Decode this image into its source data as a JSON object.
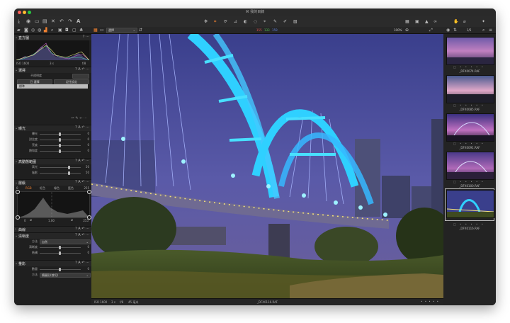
{
  "window": {
    "title": "⌘ 我的目錄",
    "traffic_colors": [
      "#ff5f57",
      "#febc2e",
      "#28c840"
    ]
  },
  "toolbar": {
    "left_icons": [
      "import-icon",
      "library-icon",
      "layers-icon",
      "filmstrip-icon",
      "close-icon",
      "undo-icon",
      "redo-icon",
      "text-icon"
    ],
    "center_icons": [
      "pan-icon",
      "crop-icon",
      "rotate-icon",
      "keystone-icon",
      "mask-icon",
      "spot-icon",
      "picker-icon",
      "brush-icon",
      "eraser-icon",
      "gradient-icon"
    ],
    "right_icons": [
      "grid-icon",
      "proof-icon",
      "warning-icon",
      "glasses-icon",
      "hand-icon",
      "eyedropper-icon",
      "settings-icon"
    ]
  },
  "viewerbar": {
    "view_select": "選擇",
    "rgb_r": "155",
    "rgb_g": "133",
    "rgb_b": "159",
    "zoom": "100%",
    "page_count": "1/5"
  },
  "left": {
    "histogram": {
      "title": "直方圖",
      "iso": "ISO 1600",
      "shutter": "3 s",
      "aperture": "f/8"
    },
    "preset": {
      "title": "選擇",
      "style_label": "不透明度",
      "style_value": "",
      "button_left": "已 選擇",
      "button_right": "記住設定",
      "selected_item": "標準"
    },
    "exposure": {
      "title": "曝光",
      "rows": [
        {
          "label": "曝光",
          "value": "0"
        },
        {
          "label": "對比度",
          "value": "0"
        },
        {
          "label": "亮度",
          "value": "0"
        },
        {
          "label": "飽和度",
          "value": "0"
        }
      ]
    },
    "hdr": {
      "title": "高動態範圍",
      "rows": [
        {
          "label": "高光",
          "value": "50"
        },
        {
          "label": "陰影",
          "value": "50"
        }
      ]
    },
    "levels": {
      "title": "層級",
      "tabs": [
        "RGB",
        "紅色",
        "綠色",
        "藍色"
      ],
      "input_min": "0",
      "input_mid": "1.00",
      "input_max": "255",
      "output_min": "0",
      "output_max": "255",
      "curve_max": "255"
    },
    "curves": {
      "title": "曲線"
    },
    "clarity": {
      "title": "清晰度",
      "rows": [
        {
          "label": "方法",
          "value": "自然"
        },
        {
          "label": "清晰度",
          "value": "0"
        },
        {
          "label": "結構",
          "value": "0"
        }
      ]
    },
    "vignette": {
      "title": "暈影",
      "rows": [
        {
          "label": "數量",
          "value": "0"
        },
        {
          "label": "方法",
          "value": "橢圓形(裁切)"
        }
      ]
    }
  },
  "thumbnails": [
    {
      "name": "_DFX0074.RAF"
    },
    {
      "name": "_DFX0085.RAF"
    },
    {
      "name": "_DFX0091.RAF"
    },
    {
      "name": "_DFX0100.RAF"
    },
    {
      "name": "_DFX0116.RAF"
    }
  ],
  "status": {
    "iso": "ISO 1600",
    "shutter": "3 s",
    "aperture": "f/8",
    "focal": "45 毫米",
    "filename": "_DFX0116.RAF",
    "rating": "• • • • •"
  }
}
